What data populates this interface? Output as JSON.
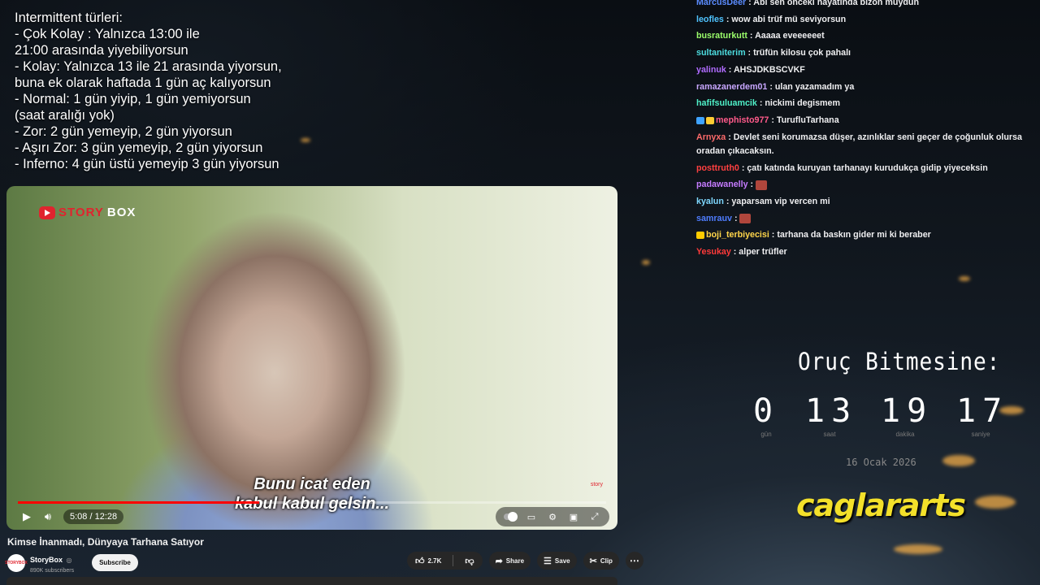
{
  "notes": {
    "lines": [
      "Intermittent türleri:",
      "- Çok Kolay : Yalnızca 13:00 ile",
      "21:00 arasında yiyebiliyorsun",
      "- Kolay: Yalnızca 13 ile 21 arasında yiyorsun,",
      "buna ek olarak haftada 1 gün aç kalıyorsun",
      "- Normal: 1 gün yiyip, 1 gün yemiyorsun",
      "(saat aralığı yok)",
      "- Zor: 2 gün yemeyip, 2 gün yiyorsun",
      "- Aşırı Zor: 3 gün yemeyip, 2 gün yiyorsun",
      "- Inferno: 4 gün üstü yemeyip 3 gün yiyorsun"
    ]
  },
  "video": {
    "logo_story": "STORY",
    "logo_box": "BOX",
    "subtitle_line1": "Bunu icat eden",
    "subtitle_line2": "kabul kabul gelsin...",
    "watermark": "story",
    "time": "5:08 / 12:28",
    "progress": 0.41,
    "play_icon": "play-icon",
    "volume_icon": "volume-icon"
  },
  "video_title": "Kimse İnanmadı, Dünyaya Tarhana Satıyor",
  "channel": {
    "name": "StoryBox",
    "verified": "◎",
    "subscribers": "890K subscribers",
    "avatar_text": "STORYBOX",
    "subscribe_label": "Subscribe"
  },
  "actions": {
    "likes": "2.7K",
    "share": "Share",
    "save": "Save",
    "clip": "Clip"
  },
  "chat": [
    {
      "user": "MarcusDeer",
      "color": "#5b8cff",
      "text": "Abi sen önceki hayatında bizon muydun"
    },
    {
      "user": "leofles",
      "color": "#4fc3ff",
      "text": "wow abi trüf mü seviyorsun"
    },
    {
      "user": "busraturkutt",
      "color": "#9cff6b",
      "text": "Aaaaa eveeeeeet"
    },
    {
      "user": "sultaniterim",
      "color": "#4ddde0",
      "text": "trüfün kilosu çok pahalı"
    },
    {
      "user": "yalinuk",
      "color": "#b06bff",
      "text": "AHSJDKBSCVKF"
    },
    {
      "user": "ramazanerdem01",
      "color": "#c8a7ff",
      "text": "ulan yazamadım ya"
    },
    {
      "user": "hafifsuluamcik",
      "color": "#4ff0c8",
      "text": "nickimi degismem"
    },
    {
      "user": "mephisto977",
      "color": "#ff5a8a",
      "text": "TurufluTarhana",
      "badges": [
        "#3fa3ff",
        "#ffcc33"
      ]
    },
    {
      "user": "Arnyxa",
      "color": "#ff6b6b",
      "text": "Devlet seni korumazsa düşer, azınlıklar seni geçer de çoğunluk olursa oradan çıkacaksın.",
      "wrap": true
    },
    {
      "user": "posttruth0",
      "color": "#ff4040",
      "text": "çatı katında kuruyan tarhanayı kurudukça gidip yiyeceksin"
    },
    {
      "user": "padawanelly",
      "color": "#c57bff",
      "text": "",
      "emote": true
    },
    {
      "user": "kyalun",
      "color": "#7fd8ff",
      "text": "yaparsam vip vercen mi"
    },
    {
      "user": "samrauv",
      "color": "#4f7dff",
      "text": "",
      "emote": true
    },
    {
      "user": "boji_terbiyecisi",
      "color": "#ffd54a",
      "text": "tarhana da baskın gider mi ki beraber",
      "badges": [
        "#ffcc00"
      ]
    },
    {
      "user": "Yesukay",
      "color": "#ff3a3a",
      "text": "alper trüfler"
    }
  ],
  "countdown": {
    "title": "Oruç Bitmesine:",
    "units": [
      {
        "value": "0",
        "label": "gün"
      },
      {
        "value": "13",
        "label": "saat"
      },
      {
        "value": "19",
        "label": "dakika"
      },
      {
        "value": "17",
        "label": "saniye"
      }
    ],
    "date": "16 Ocak 2026"
  },
  "brand": "caglararts"
}
